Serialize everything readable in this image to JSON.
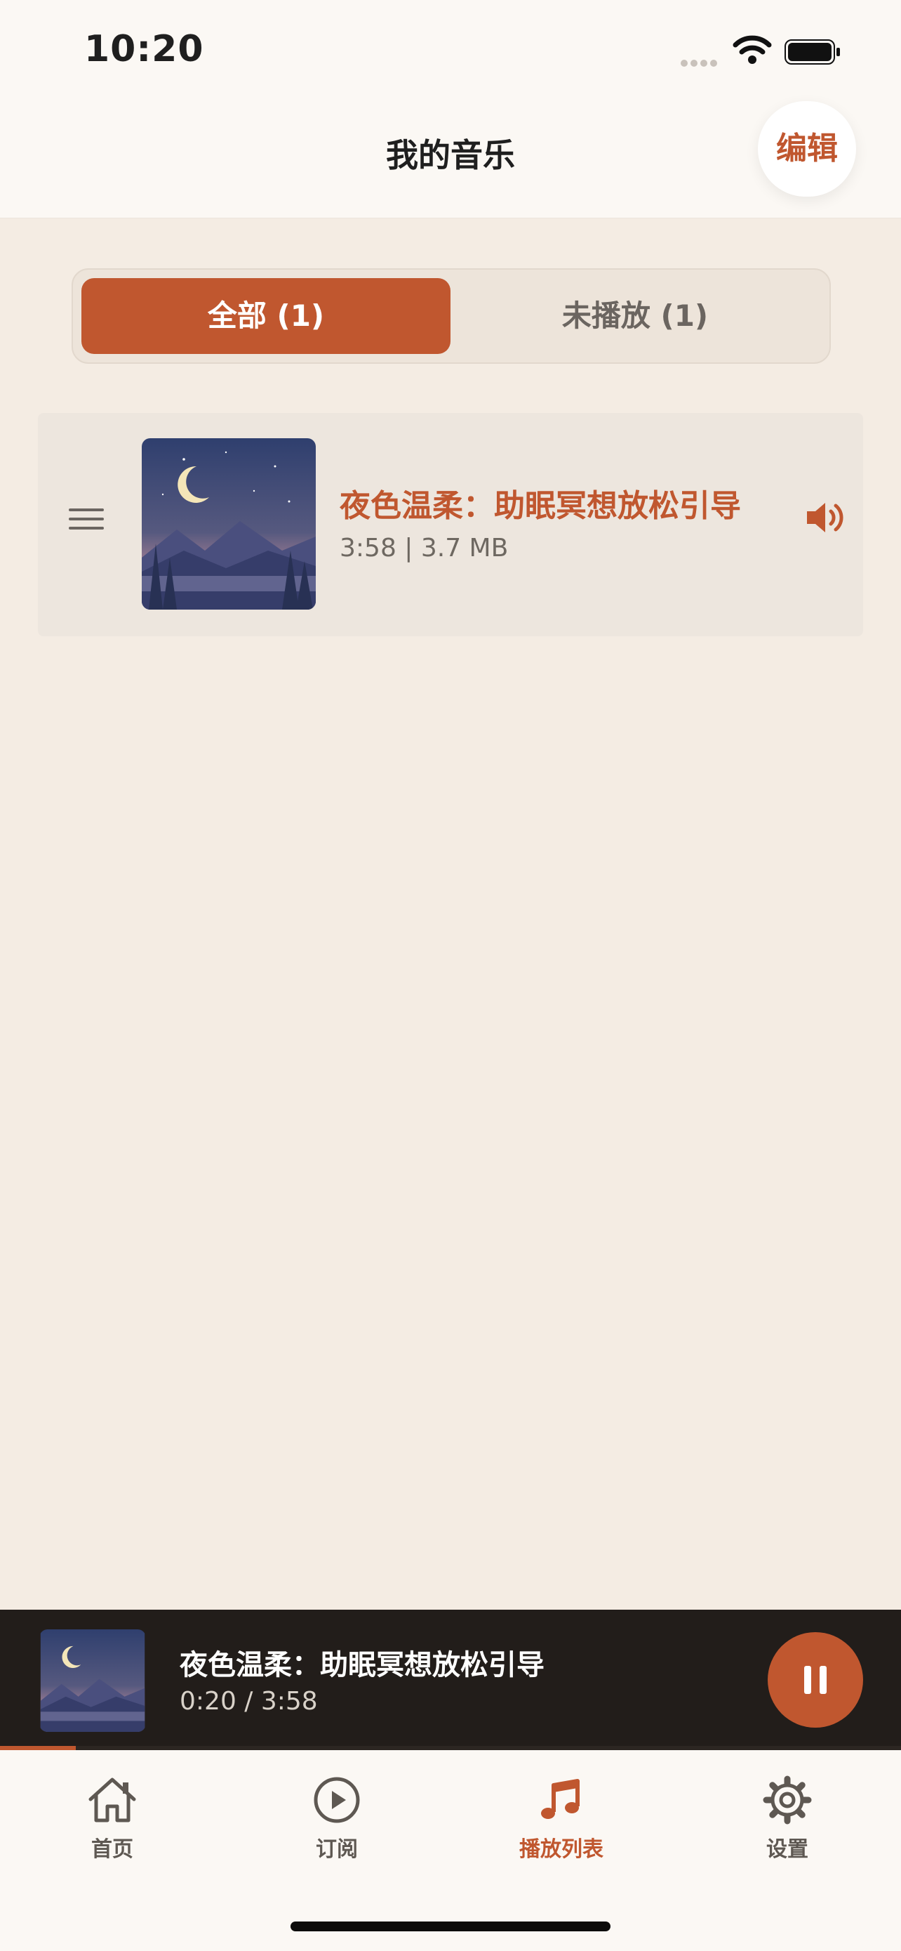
{
  "status": {
    "time": "10:20"
  },
  "header": {
    "title": "我的音乐",
    "edit_label": "编辑"
  },
  "tabs": {
    "all_label": "全部 (1)",
    "unplayed_label": "未播放 (1)"
  },
  "tracks": [
    {
      "title": "夜色温柔：助眠冥想放松引导",
      "meta": "3:58 | 3.7 MB"
    }
  ],
  "player": {
    "title": "夜色温柔：助眠冥想放松引导",
    "time": "0:20 / 3:58",
    "progress": 0.084
  },
  "bottom_nav": [
    {
      "label": "首页",
      "icon": "home-icon"
    },
    {
      "label": "订阅",
      "icon": "play-circle-icon"
    },
    {
      "label": "播放列表",
      "icon": "music-note-icon",
      "active": true
    },
    {
      "label": "设置",
      "icon": "gear-icon"
    }
  ],
  "colors": {
    "accent": "#c0572f",
    "background": "#f4ece3",
    "player_bg": "#221d1a"
  }
}
